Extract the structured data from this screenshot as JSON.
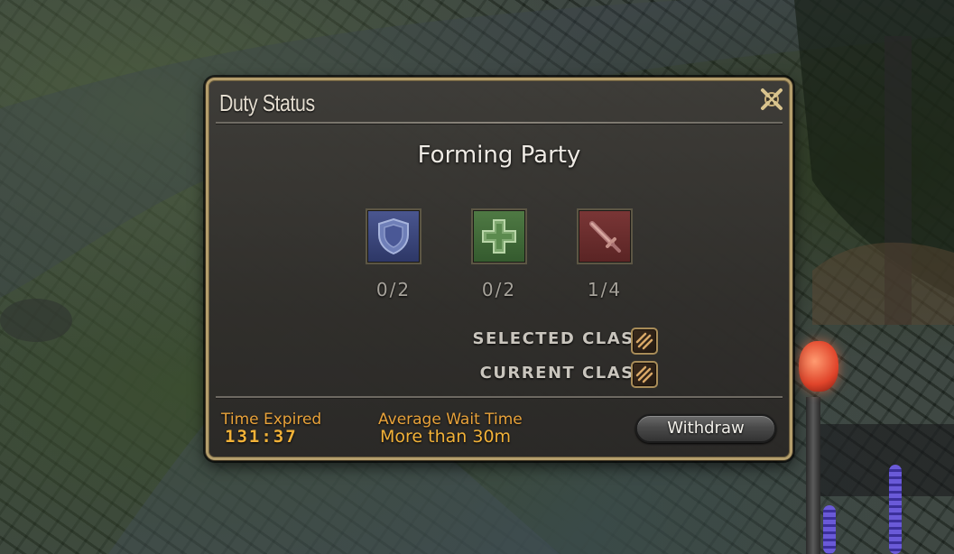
{
  "window": {
    "title": "Duty Status",
    "status": "Forming Party"
  },
  "roles": [
    {
      "name": "tank",
      "count": "0/2",
      "color": "#4a5690"
    },
    {
      "name": "healer",
      "count": "0/2",
      "color": "#4f7a44"
    },
    {
      "name": "dps",
      "count": "1/4",
      "color": "#7a3636"
    }
  ],
  "classes": {
    "selected_label": "SELECTED CLASS:",
    "current_label": "CURRENT CLASS:"
  },
  "footer": {
    "time_expired_label": "Time Expired",
    "time_expired_value": "131:37",
    "wait_label": "Average Wait Time",
    "wait_value": "More than 30m",
    "withdraw_label": "Withdraw"
  },
  "colors": {
    "accent_gold": "#b49e6c",
    "timer_orange": "#e8a23a"
  }
}
